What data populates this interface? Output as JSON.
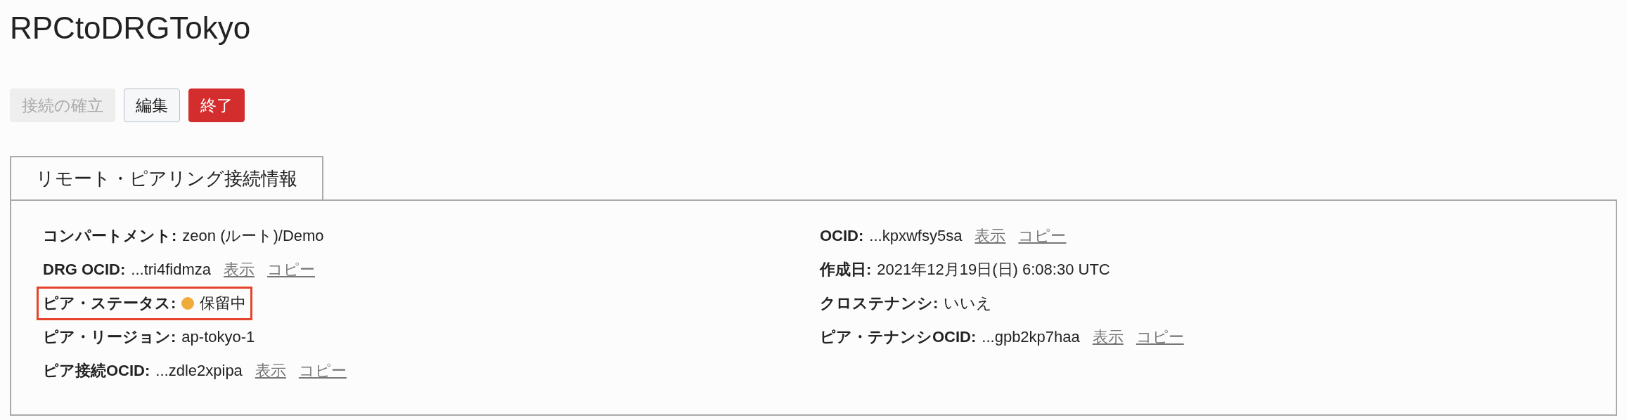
{
  "title": "RPCtoDRGTokyo",
  "buttons": [
    {
      "label": "接続の確立",
      "kind": "default",
      "disabled": true
    },
    {
      "label": "編集",
      "kind": "default",
      "disabled": false
    },
    {
      "label": "終了",
      "kind": "danger",
      "disabled": false
    }
  ],
  "tabs": [
    {
      "label": "リモート・ピアリング接続情報",
      "selected": true
    }
  ],
  "details": {
    "left": [
      {
        "label": "コンパートメント:",
        "value": "zeon (ルート)/Demo",
        "kind": "text",
        "highlighted": false
      },
      {
        "label": "DRG OCID:",
        "value": "...tri4fidmza",
        "kind": "ocid",
        "links": [
          "表示",
          "コピー"
        ],
        "highlighted": false
      },
      {
        "label": "ピア・ステータス:",
        "value": "保留中",
        "kind": "status",
        "color": "#f0ac3a",
        "highlighted": true
      },
      {
        "label": "ピア・リージョン:",
        "value": "ap-tokyo-1",
        "kind": "text",
        "highlighted": false
      },
      {
        "label": "ピア接続OCID:",
        "value": "...zdle2xpipa",
        "kind": "ocid",
        "links": [
          "表示",
          "コピー"
        ],
        "highlighted": false
      }
    ],
    "right": [
      {
        "label": "OCID:",
        "value": "...kpxwfsy5sa",
        "kind": "ocid",
        "links": [
          "表示",
          "コピー"
        ],
        "highlighted": false
      },
      {
        "label": "作成日:",
        "value": "2021年12月19日(日) 6:08:30 UTC",
        "kind": "text",
        "highlighted": false
      },
      {
        "label": "クロステナンシ:",
        "value": "いいえ",
        "kind": "text",
        "highlighted": false
      },
      {
        "label": "ピア・テナンシOCID:",
        "value": "...gpb2kp7haa",
        "kind": "ocid",
        "links": [
          "表示",
          "コピー"
        ],
        "highlighted": false
      }
    ]
  }
}
